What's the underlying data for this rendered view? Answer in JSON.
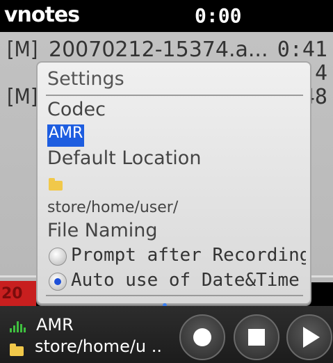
{
  "header": {
    "app_title": "vnotes",
    "time": "0:00"
  },
  "recordings": [
    {
      "tag": "[M]",
      "name": "20070212-15374.a...",
      "duration": "0:41"
    },
    {
      "tag": "",
      "name": "",
      "duration": "4"
    },
    {
      "tag": "[M]",
      "name": "",
      "duration": "48"
    }
  ],
  "settings_dialog": {
    "title": "Settings",
    "codec_label": "Codec",
    "codec_value": "AMR",
    "default_location_label": "Default Location",
    "location_path": "store/home/user/",
    "file_naming_label": "File Naming",
    "options": [
      {
        "label": "Prompt after Recording",
        "selected": false
      },
      {
        "label": "Auto use of Date&Time",
        "selected": true
      }
    ]
  },
  "background_fragment": {
    "text": "20"
  },
  "bottom_bar": {
    "codec": "AMR",
    "path": "store/home/u ..",
    "controls": [
      {
        "name": "record",
        "icon": "record-icon"
      },
      {
        "name": "stop",
        "icon": "stop-icon"
      },
      {
        "name": "play",
        "icon": "play-icon"
      }
    ]
  },
  "colors": {
    "selection": "#1d5de0",
    "radio_selected": "#1d4fd8",
    "folder": "#f1c84a",
    "signal": "#3fbf3f",
    "accent_red": "#c81f1f"
  }
}
